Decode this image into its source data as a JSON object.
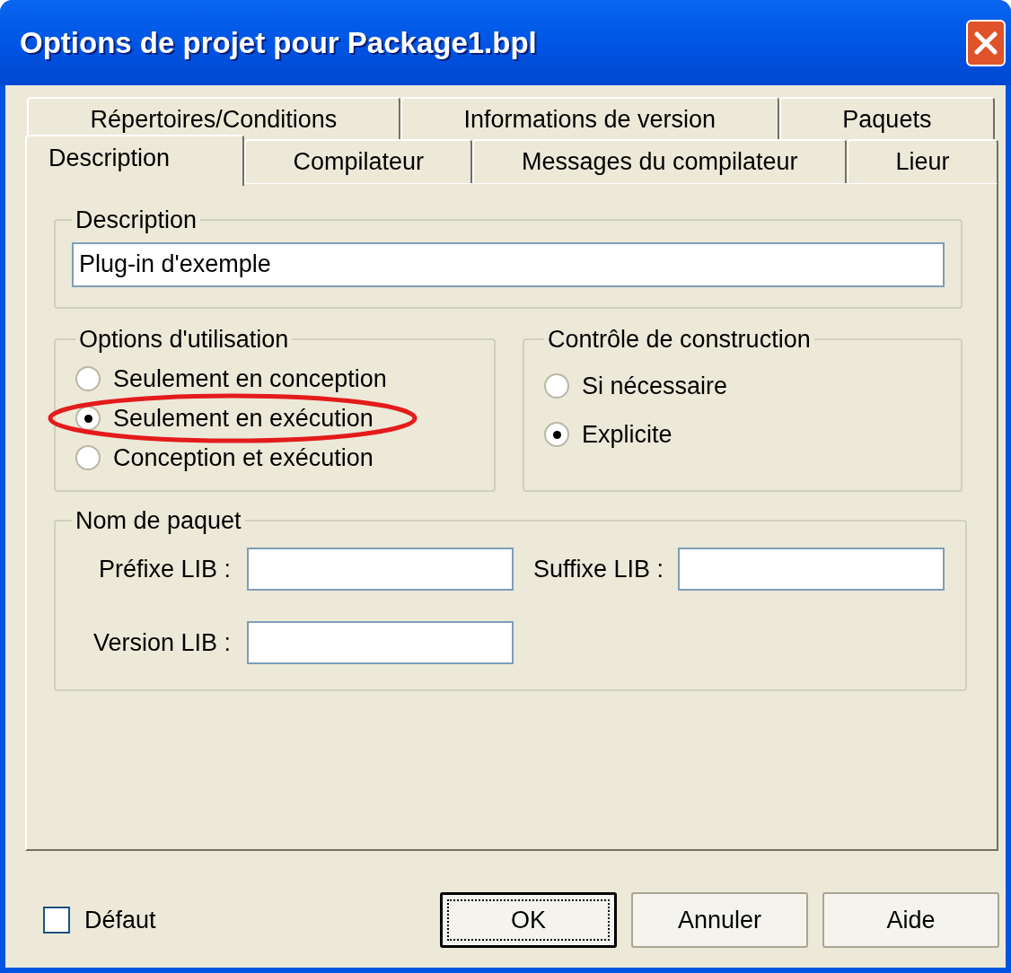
{
  "window": {
    "title": "Options de projet pour Package1.bpl"
  },
  "tab_rows": [
    [
      {
        "label": "Répertoires/Conditions",
        "selected": false
      },
      {
        "label": "Informations de version",
        "selected": false
      },
      {
        "label": "Paquets",
        "selected": false
      }
    ],
    [
      {
        "label": "Description",
        "selected": true
      },
      {
        "label": "Compilateur",
        "selected": false
      },
      {
        "label": "Messages du compilateur",
        "selected": false
      },
      {
        "label": "Lieur",
        "selected": false
      }
    ]
  ],
  "description_group": {
    "label": "Description",
    "value": "Plug-in d'exemple"
  },
  "usage_options": {
    "label": "Options d'utilisation",
    "options": [
      {
        "label": "Seulement en conception",
        "selected": false,
        "circled": false
      },
      {
        "label": "Seulement en exécution",
        "selected": true,
        "circled": true
      },
      {
        "label": "Conception et exécution",
        "selected": false,
        "circled": false
      }
    ]
  },
  "build_control": {
    "label": "Contrôle de construction",
    "options": [
      {
        "label": "Si nécessaire",
        "selected": false
      },
      {
        "label": "Explicite",
        "selected": true
      }
    ]
  },
  "package_name": {
    "label": "Nom de paquet",
    "prefix_label": "Préfixe LIB :",
    "suffix_label": "Suffixe LIB :",
    "version_label": "Version LIB :"
  },
  "default_checkbox": {
    "label": "Défaut",
    "checked": false
  },
  "buttons": [
    {
      "label": "OK",
      "default": true
    },
    {
      "label": "Annuler",
      "default": false
    },
    {
      "label": "Aide",
      "default": false
    }
  ]
}
